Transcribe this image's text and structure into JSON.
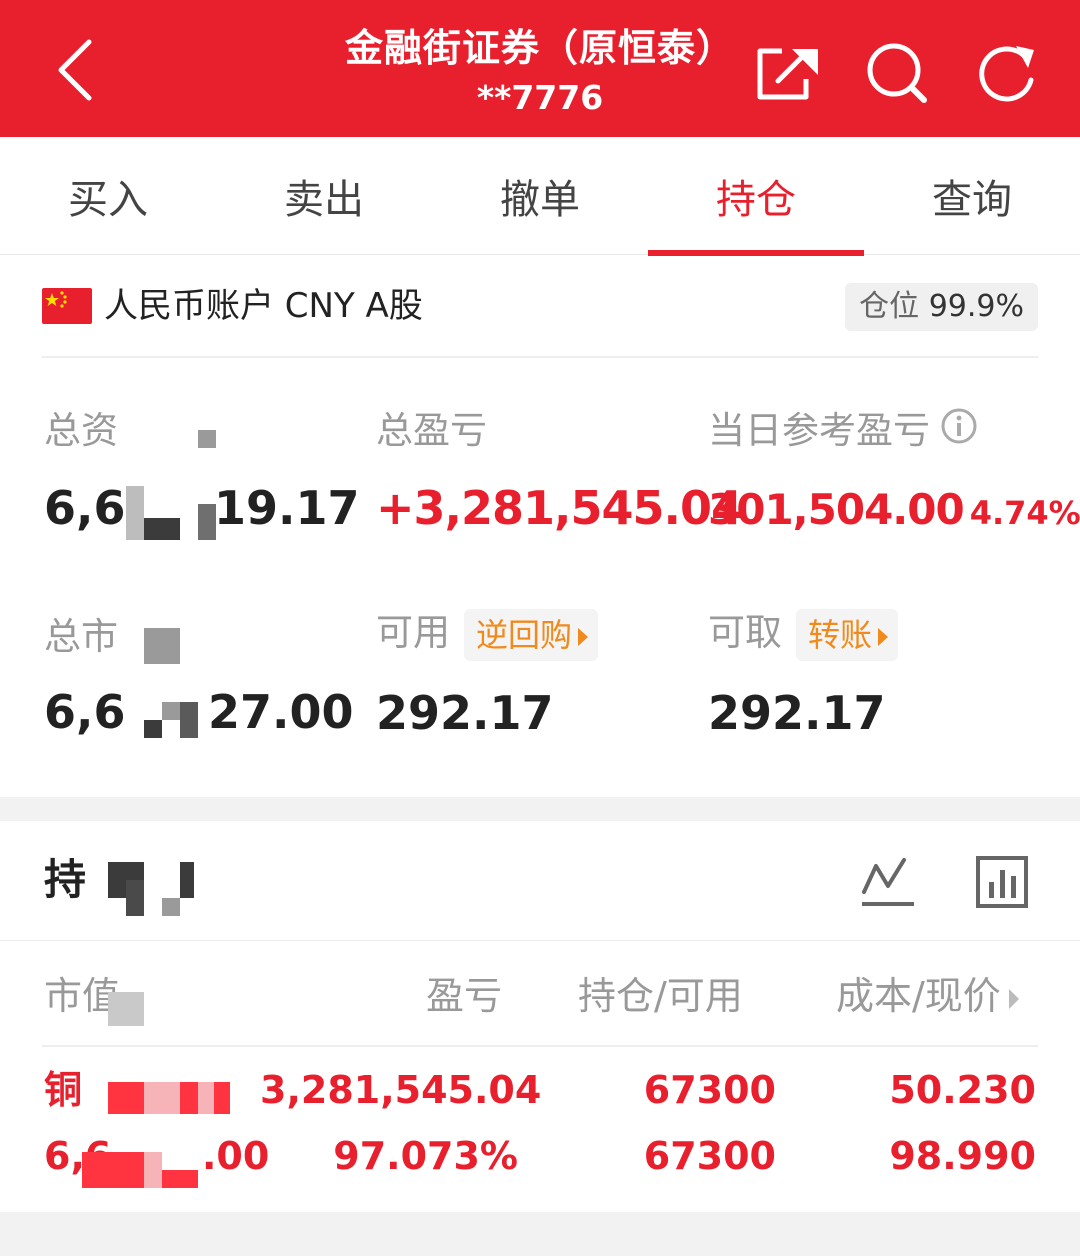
{
  "header": {
    "title": "金融街证券（原恒泰）",
    "subtitle": "**7776"
  },
  "tabs": [
    {
      "label": "买入"
    },
    {
      "label": "卖出"
    },
    {
      "label": "撤单"
    },
    {
      "label": "持仓"
    },
    {
      "label": "查询"
    }
  ],
  "account": {
    "label": "人民币账户 CNY A股",
    "position_label": "仓位",
    "position_value": "99.9%"
  },
  "stats": {
    "total_assets": {
      "label": "总资",
      "value_left": "6,6",
      "value_right": "19.17"
    },
    "total_pnl": {
      "label": "总盈亏",
      "value": "+3,281,545.04"
    },
    "daily_pnl": {
      "label": "当日参考盈亏",
      "value": "301,504.00",
      "pct": "4.74%"
    },
    "market_value": {
      "label": "总市",
      "value_left": "6,6",
      "value_right": "27.00"
    },
    "available": {
      "label": "可用",
      "tag": "逆回购",
      "value": "292.17"
    },
    "withdrawable": {
      "label": "可取",
      "tag": "转账",
      "value": "292.17"
    }
  },
  "holdings": {
    "title": "持",
    "columns": {
      "market_value": "市值",
      "pnl": "盈亏",
      "position": "持仓/可用",
      "cost_price": "成本/现价"
    },
    "rows": [
      {
        "name_left": "铜",
        "market_value_right": ".00",
        "market_value_left": "6,6",
        "pnl": "3,281,545.04",
        "pnl_pct": "97.073%",
        "position": "67300",
        "available": "67300",
        "cost": "50.230",
        "price": "98.990"
      }
    ]
  },
  "colors": {
    "brand_red": "#e8202e",
    "tag_orange": "#f08a1c",
    "label_gray": "#999999"
  }
}
